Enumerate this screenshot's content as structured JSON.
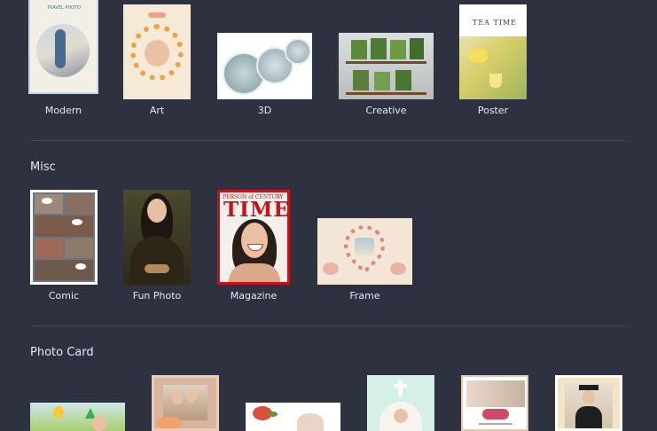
{
  "sections": {
    "row1_labels": [
      "Modern",
      "Art",
      "3D",
      "Creative",
      "Poster"
    ],
    "misc_title": "Misc",
    "misc_labels": [
      "Comic",
      "Fun Photo",
      "Magazine",
      "Frame"
    ],
    "photocard_title": "Photo Card"
  },
  "thumbs": {
    "modern_caption": "TRAVEL PHOTO",
    "poster_caption": "TEA TIME",
    "magazine_caption": "TIME",
    "magazine_kicker": "PERSON of CENTURY"
  },
  "colors": {
    "background": "#2e3140",
    "divider": "#474a59",
    "magazine_red": "#c5121b"
  }
}
